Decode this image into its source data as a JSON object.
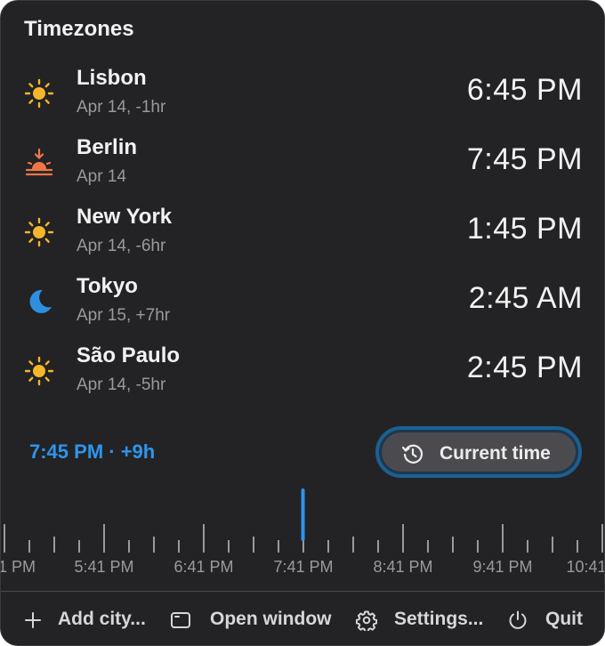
{
  "header": {
    "title": "Timezones"
  },
  "zones": [
    {
      "city": "Lisbon",
      "sub": "Apr 14, -1hr",
      "time": "6:45 PM",
      "icon": "sun-icon"
    },
    {
      "city": "Berlin",
      "sub": "Apr 14",
      "time": "7:45 PM",
      "icon": "sunset-icon"
    },
    {
      "city": "New York",
      "sub": "Apr 14, -6hr",
      "time": "1:45 PM",
      "icon": "sun-icon"
    },
    {
      "city": "Tokyo",
      "sub": "Apr 15, +7hr",
      "time": "2:45 AM",
      "icon": "moon-icon"
    },
    {
      "city": "São Paulo",
      "sub": "Apr 14, -5hr",
      "time": "2:45 PM",
      "icon": "sun-icon"
    }
  ],
  "selection": {
    "label": "7:45 PM · +9h"
  },
  "current_button": {
    "label": "Current time",
    "icon": "history-icon"
  },
  "timeline": {
    "labels": [
      "1 PM",
      "5:41 PM",
      "6:41 PM",
      "7:41 PM",
      "8:41 PM",
      "9:41 PM",
      "10:41"
    ]
  },
  "footer": {
    "add": "Add city...",
    "open": "Open window",
    "settings": "Settings...",
    "quit": "Quit"
  },
  "colors": {
    "accent": "#2e95ec",
    "sun": "#f5b62b",
    "sunset": "#f0764a",
    "moon": "#2e8fe0"
  }
}
